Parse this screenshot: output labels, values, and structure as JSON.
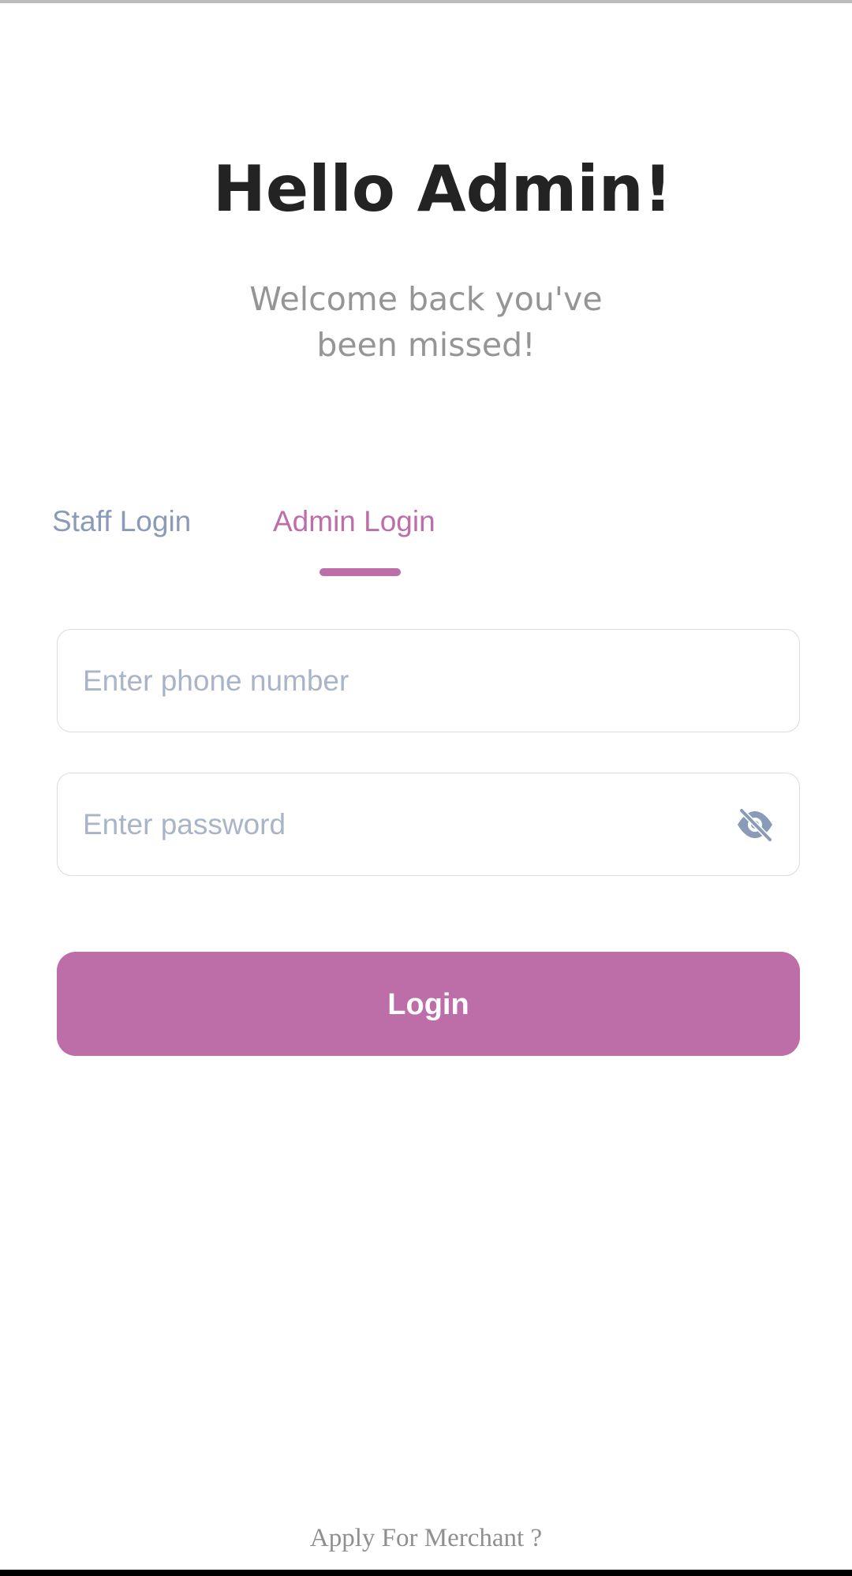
{
  "header": {
    "title": "Hello Admin!",
    "subtitle_line1": "Welcome back you've",
    "subtitle_line2": "been missed!"
  },
  "tabs": [
    {
      "label": "Staff Login",
      "active": false
    },
    {
      "label": "Admin Login",
      "active": true
    }
  ],
  "form": {
    "phone_placeholder": "Enter phone number",
    "phone_value": "",
    "password_placeholder": "Enter password",
    "password_value": "",
    "password_visibility_icon": "eye-off-icon",
    "login_label": "Login"
  },
  "footer": {
    "merchant_link": "Apply For Merchant ?"
  },
  "colors": {
    "accent": "#bd6da7",
    "inactive_tab": "#8a9bb8",
    "title": "#232323",
    "subtitle": "#959595",
    "placeholder": "#a9b4c8"
  }
}
